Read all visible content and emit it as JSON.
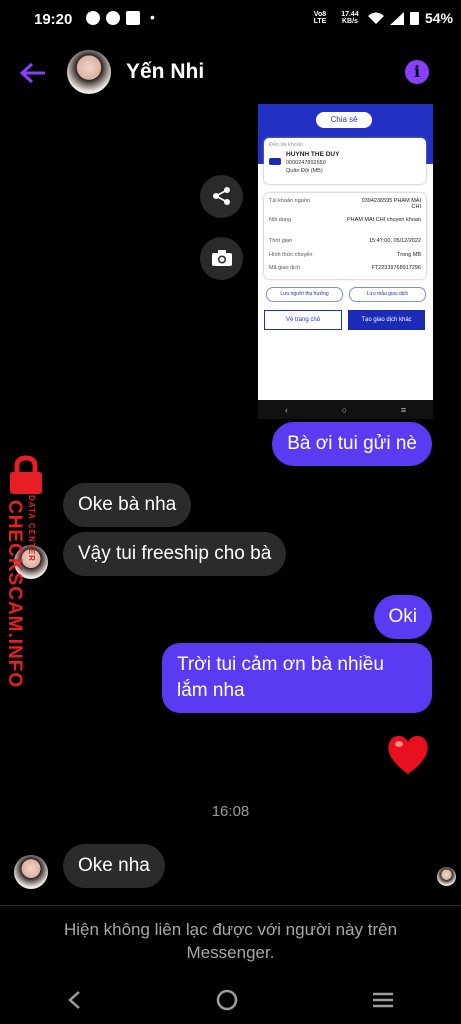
{
  "status_bar": {
    "time": "19:20",
    "network": "Vo8 LTE",
    "speed": "17.44 KB/s",
    "battery": "54%"
  },
  "header": {
    "contact_name": "Yến Nhi",
    "back_icon": "arrow-left-icon",
    "info_icon": "info-icon"
  },
  "shared_image": {
    "share_label": "Chia sẻ",
    "to_account_label": "Đến tài khoản",
    "recipient_name": "HUYNH THE DUY",
    "recipient_account": "0000247892650",
    "recipient_bank": "Quân Đội (MB)",
    "rows": [
      {
        "label": "Tài khoản nguồn",
        "value": "0394236595 PHAM MAI CHI"
      },
      {
        "label": "Nội dung",
        "value": "PHAM MAI CHI chuyen khoan"
      },
      {
        "label": "Thời gian",
        "value": "15:47:00, 05/12/2022"
      },
      {
        "label": "Hình thức chuyển",
        "value": "Trong MB"
      },
      {
        "label": "Mã giao dịch",
        "value": "FT22339768917296"
      }
    ],
    "save_beneficiary": "Lưu người thụ hưởng",
    "save_template": "Lưu mẫu giao dịch",
    "home_button": "Về trang chủ",
    "new_transaction_button": "Tạo giao dịch khác"
  },
  "messages": {
    "m1": "Bà ơi tui gửi nè",
    "m2": "Oke bà nha",
    "m3": "Vậy tui freeship cho bà",
    "m4": "Oki",
    "m5": "Trời tui cảm ơn bà nhiều lắm nha",
    "time_separator": "16:08",
    "m6": "Oke nha"
  },
  "watermark": {
    "main": "CHECKSCAM.INFO",
    "sub": "DATA CENTER"
  },
  "footer": {
    "notice": "Hiện không liên lạc được với người này trên Messenger."
  },
  "colors": {
    "accent": "#8a3ffc",
    "outgoing_bubble": "#5b3bf2",
    "incoming_bubble": "#2b2b2b",
    "watermark": "#e81e25"
  }
}
